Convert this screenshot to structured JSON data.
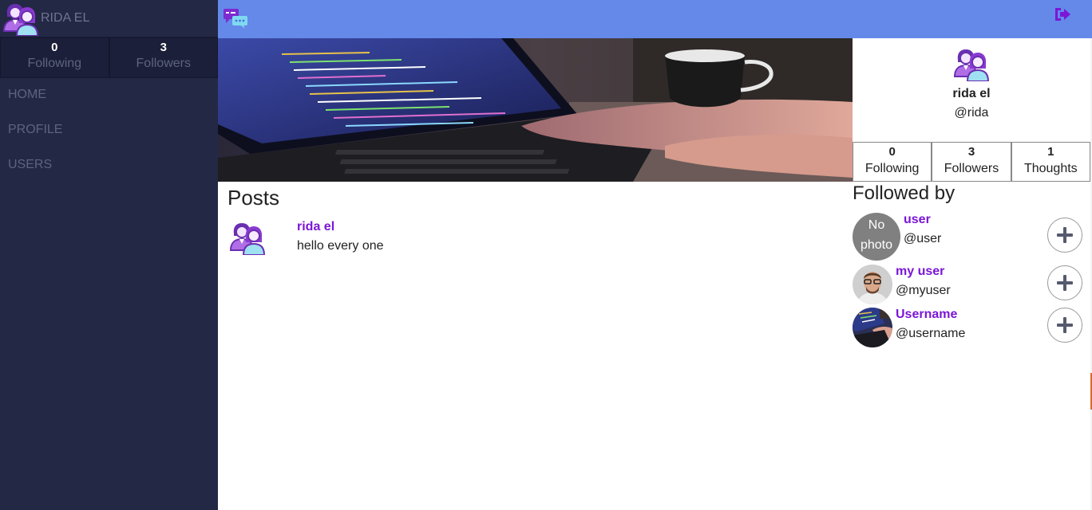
{
  "sidebar": {
    "user_name": "RIDA EL",
    "stats": [
      {
        "count": "0",
        "label": "Following"
      },
      {
        "count": "3",
        "label": "Followers"
      }
    ],
    "nav": [
      {
        "label": "HOME"
      },
      {
        "label": "PROFILE"
      },
      {
        "label": "USERS"
      }
    ]
  },
  "topbar": {
    "logo_icon": "chat-bubbles-icon",
    "logout_icon": "sign-out-icon",
    "bg_color": "#6489e9"
  },
  "profile": {
    "name": "rida el",
    "handle": "@rida",
    "stats": [
      {
        "count": "0",
        "label": "Following"
      },
      {
        "count": "3",
        "label": "Followers"
      },
      {
        "count": "1",
        "label": "Thoughts"
      }
    ]
  },
  "posts": {
    "title": "Posts",
    "items": [
      {
        "author": "rida el",
        "text": "hello every one"
      }
    ]
  },
  "followed_by": {
    "title": "Followed by",
    "no_photo_line1": "No",
    "no_photo_line2": "photo",
    "users": [
      {
        "name": "user",
        "handle": "@user"
      },
      {
        "name": "my user",
        "handle": "@myuser"
      },
      {
        "name": "Username",
        "handle": "@username"
      }
    ]
  },
  "colors": {
    "sidebar_bg": "#232845",
    "accent_purple": "#7b16d6",
    "topbar": "#6489e9"
  }
}
